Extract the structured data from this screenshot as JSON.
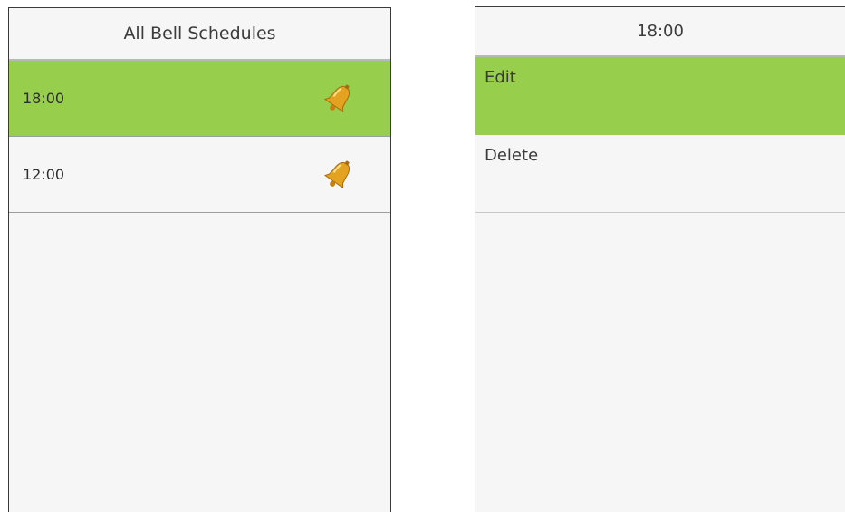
{
  "left_screen": {
    "title": "All Bell Schedules",
    "items": [
      {
        "time": "18:00",
        "icon": "bell-icon",
        "selected": true
      },
      {
        "time": "12:00",
        "icon": "bell-icon",
        "selected": false
      }
    ]
  },
  "right_screen": {
    "title": "18:00",
    "menu": [
      {
        "label": "Edit",
        "selected": true
      },
      {
        "label": "Delete",
        "selected": false
      }
    ]
  },
  "colors": {
    "selection": "#97cf4d",
    "background": "#f6f6f6",
    "bell": "#e3a21f"
  }
}
